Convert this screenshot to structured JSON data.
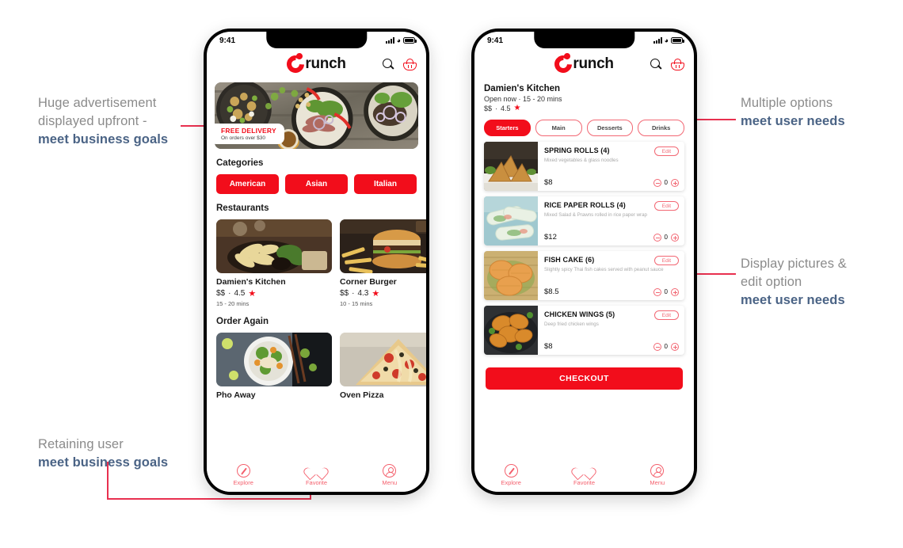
{
  "annotations": [
    {
      "id": "ad",
      "lines": [
        "Huge advertisement",
        "displayed upfront -"
      ],
      "bold": "meet business goals"
    },
    {
      "id": "retain",
      "lines": [
        "Retaining user"
      ],
      "bold": "meet business goals"
    },
    {
      "id": "options",
      "lines": [
        "Multiple options"
      ],
      "bold": "meet user needs"
    },
    {
      "id": "pictures",
      "lines": [
        "Display pictures &",
        "edit option"
      ],
      "bold": "meet user needs"
    }
  ],
  "colors": {
    "brand_red": "#f20d1b",
    "line_red": "#e8304f",
    "anno_gray": "#8b8b8b",
    "anno_blue": "#4a6385"
  },
  "phone1": {
    "status": {
      "time": "9:41"
    },
    "appbar": {
      "logo_first": "C",
      "logo_rest": "runch",
      "search_icon": "search-icon",
      "cart_icon": "basket-icon"
    },
    "hero": {
      "badge_title": "FREE DELIVERY",
      "badge_sub": "On orders over $30"
    },
    "categories_title": "Categories",
    "categories": [
      "American",
      "Asian",
      "Italian"
    ],
    "restaurants_title": "Restaurants",
    "restaurants": [
      {
        "name": "Damien's Kitchen",
        "price": "$$",
        "dot": "·",
        "rating": "4.5",
        "star": "★",
        "time": "15 - 20 mins"
      },
      {
        "name": "Corner Burger",
        "price": "$$",
        "dot": "·",
        "rating": "4.3",
        "star": "★",
        "time": "10 - 15 mins"
      }
    ],
    "order_again_title": "Order Again",
    "order_again": [
      {
        "name": "Pho Away"
      },
      {
        "name": "Oven Pizza"
      }
    ],
    "tabbar": [
      {
        "label": "Explore",
        "icon": "compass-icon"
      },
      {
        "label": "Favorite",
        "icon": "heart-icon"
      },
      {
        "label": "Menu",
        "icon": "person-icon"
      }
    ]
  },
  "phone2": {
    "status": {
      "time": "9:41"
    },
    "appbar": {
      "logo_first": "C",
      "logo_rest": "runch",
      "search_icon": "search-icon",
      "cart_icon": "basket-icon"
    },
    "restaurant": {
      "name": "Damien's Kitchen",
      "status_line": "Open now  ·  15 - 20 mins",
      "price": "$$",
      "dot": "·",
      "rating": "4.5",
      "star": "★"
    },
    "tabs": [
      {
        "label": "Starters",
        "selected": true
      },
      {
        "label": "Main",
        "selected": false
      },
      {
        "label": "Desserts",
        "selected": false
      },
      {
        "label": "Drinks",
        "selected": false
      }
    ],
    "menu_items": [
      {
        "title": "SPRING ROLLS (4)",
        "desc": "Mixed vegetables & glass noodles",
        "price": "$8",
        "qty": "0",
        "edit": "Edit"
      },
      {
        "title": "RICE PAPER ROLLS (4)",
        "desc": "Mixed Salad & Prawns rolled in rice paper wrap",
        "price": "$12",
        "qty": "0",
        "edit": "Edit"
      },
      {
        "title": "FISH CAKE (6)",
        "desc": "Slightly spicy Thai fish cakes served with peanut sauce",
        "price": "$8.5",
        "qty": "0",
        "edit": "Edit"
      },
      {
        "title": "CHICKEN WINGS (5)",
        "desc": "Deep fried chicken wings",
        "price": "$8",
        "qty": "0",
        "edit": "Edit"
      }
    ],
    "checkout_label": "CHECKOUT",
    "tabbar": [
      {
        "label": "Explore",
        "icon": "compass-icon"
      },
      {
        "label": "Favorite",
        "icon": "heart-icon"
      },
      {
        "label": "Menu",
        "icon": "person-icon"
      }
    ]
  }
}
